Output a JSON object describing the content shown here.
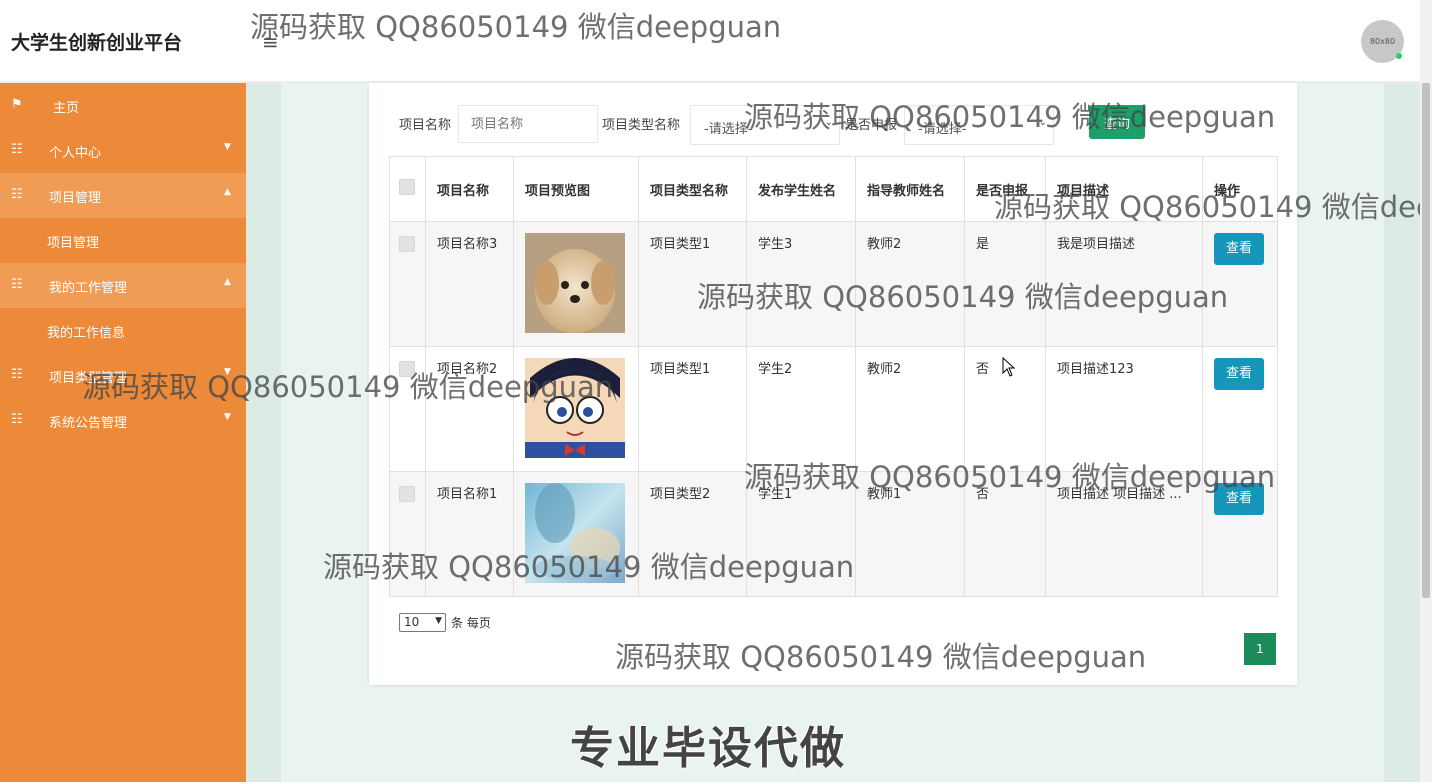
{
  "app": {
    "title": "大学生创新创业平台",
    "hamburger": "≡",
    "avatar": "80x80"
  },
  "sidebar": {
    "items": [
      {
        "label": "主页",
        "icon": "flag-icon"
      },
      {
        "label": "个人中心",
        "icon": "grid-icon",
        "caret": "▼"
      },
      {
        "label": "项目管理",
        "icon": "grid-icon",
        "caret": "▲"
      },
      {
        "label": "项目管理",
        "icon": "",
        "sub": true
      },
      {
        "label": "我的工作管理",
        "icon": "grid-icon",
        "caret": "▲"
      },
      {
        "label": "我的工作信息",
        "icon": "",
        "sub": true
      },
      {
        "label": "项目类型管理",
        "icon": "grid-icon",
        "caret": "▼"
      },
      {
        "label": "系统公告管理",
        "icon": "grid-icon",
        "caret": "▼"
      }
    ]
  },
  "filters": {
    "name_label": "项目名称",
    "name_placeholder": "项目名称",
    "type_label": "项目类型名称",
    "type_value": "-请选择-",
    "apply_label": "是否申报",
    "apply_value": "-请选择-",
    "query_button": "查询"
  },
  "table": {
    "headers": [
      "项目名称",
      "项目预览图",
      "项目类型名称",
      "发布学生姓名",
      "指导教师姓名",
      "是否申报",
      "项目描述",
      "操作"
    ],
    "rows": [
      {
        "name": "项目名称3",
        "image": "puppy",
        "type": "项目类型1",
        "student": "学生3",
        "teacher": "教师2",
        "applied": "是",
        "desc": "我是项目描述",
        "action": "查看"
      },
      {
        "name": "项目名称2",
        "image": "cartoon-boy",
        "type": "项目类型1",
        "student": "学生2",
        "teacher": "教师2",
        "applied": "否",
        "desc": "项目描述123",
        "action": "查看"
      },
      {
        "name": "项目名称1",
        "image": "blurred-scene",
        "type": "项目类型2",
        "student": "学生1",
        "teacher": "教师1",
        "applied": "否",
        "desc": "项目描述 项目描述 ...",
        "action": "查看"
      }
    ]
  },
  "pagination": {
    "page_size": "10",
    "per_page_label": "条 每页",
    "current_page": "1"
  },
  "promo": "专业毕设代做",
  "watermark": "源码获取 QQ86050149 微信deepguan",
  "colors": {
    "sidebar": "#ed8a3a",
    "sidebar_active": "#f19c55",
    "primary_green": "#1e9e69",
    "view_button": "#1696b8"
  }
}
